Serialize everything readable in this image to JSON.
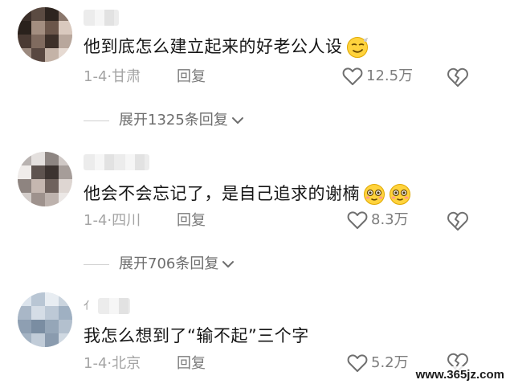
{
  "comments": [
    {
      "text": "他到底怎么建立起来的好老公人设",
      "emoji": "smirk-emoji",
      "date": "1-4",
      "location": "甘肃",
      "reply_label": "回复",
      "likes": "12.5万",
      "expand_label": "展开1325条回复"
    },
    {
      "text": "他会不会忘记了，是自己追求的谢楠",
      "emoji": "flushed-emoji",
      "date": "1-4",
      "location": "四川",
      "reply_label": "回复",
      "likes": "8.3万",
      "expand_label": "展开706条回复"
    },
    {
      "username_first_char": "ｲ",
      "text": "我怎么想到了“输不起”三个字",
      "date": "1-4",
      "location": "北京",
      "reply_label": "回复",
      "likes": "5.2万"
    }
  ],
  "separator": "·",
  "watermark": "www.365jz.com",
  "colors": {
    "text": "#161616",
    "meta": "#a4a4a4",
    "icon": "#6f6f6f",
    "emoji_face": "#ffd33d"
  }
}
